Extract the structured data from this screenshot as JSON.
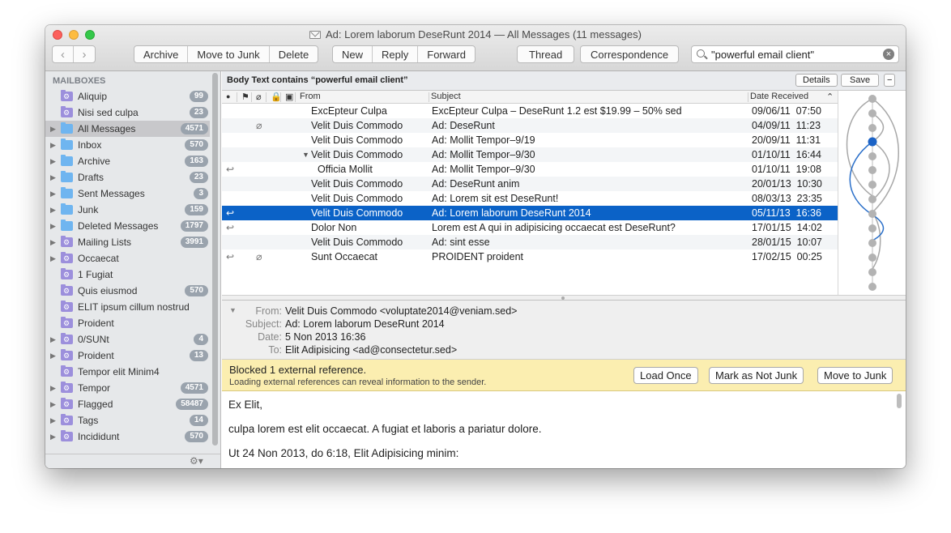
{
  "window": {
    "title": "Ad: Lorem laborum DeseRunt 2014 — All Messages (11 messages)"
  },
  "toolbar": {
    "back_icon": "chevron-left",
    "forward_icon": "chevron-right",
    "archive": "Archive",
    "move_to_junk": "Move to Junk",
    "delete": "Delete",
    "new": "New",
    "reply": "Reply",
    "forward": "Forward",
    "thread": "Thread",
    "correspondence": "Correspondence"
  },
  "search": {
    "value": "\"powerful email client\""
  },
  "sidebar": {
    "heading": "MAILBOXES",
    "items": [
      {
        "label": "Aliquip",
        "count": "99",
        "icon": "smart-folder",
        "disclosure": false,
        "selected": false
      },
      {
        "label": "Nisi sed culpa",
        "count": "23",
        "icon": "smart-folder",
        "disclosure": false,
        "selected": false
      },
      {
        "label": "All Messages",
        "count": "4571",
        "icon": "folder",
        "disclosure": true,
        "selected": true
      },
      {
        "label": "Inbox",
        "count": "570",
        "icon": "folder",
        "disclosure": true,
        "selected": false
      },
      {
        "label": "Archive",
        "count": "163",
        "icon": "folder",
        "disclosure": true,
        "selected": false
      },
      {
        "label": "Drafts",
        "count": "23",
        "icon": "folder",
        "disclosure": true,
        "selected": false
      },
      {
        "label": "Sent Messages",
        "count": "3",
        "icon": "folder",
        "disclosure": true,
        "selected": false
      },
      {
        "label": "Junk",
        "count": "159",
        "icon": "folder",
        "disclosure": true,
        "selected": false
      },
      {
        "label": "Deleted Messages",
        "count": "1797",
        "icon": "folder",
        "disclosure": true,
        "selected": false
      },
      {
        "label": "Mailing Lists",
        "count": "3991",
        "icon": "smart-folder",
        "disclosure": true,
        "selected": false
      },
      {
        "label": "Occaecat",
        "count": "",
        "icon": "smart-folder",
        "disclosure": true,
        "selected": false
      },
      {
        "label": "1 Fugiat",
        "count": "",
        "icon": "smart-folder",
        "disclosure": false,
        "selected": false
      },
      {
        "label": "Quis eiusmod",
        "count": "570",
        "icon": "smart-folder",
        "disclosure": false,
        "selected": false
      },
      {
        "label": "ELIT ipsum cillum nostrud",
        "count": "",
        "icon": "smart-folder",
        "disclosure": false,
        "selected": false
      },
      {
        "label": "Proident",
        "count": "",
        "icon": "smart-folder",
        "disclosure": false,
        "selected": false
      },
      {
        "label": "0/SUNt",
        "count": "4",
        "icon": "smart-folder",
        "disclosure": true,
        "selected": false
      },
      {
        "label": "Proident",
        "count": "13",
        "icon": "smart-folder",
        "disclosure": true,
        "selected": false
      },
      {
        "label": "Tempor elit Minim4",
        "count": "",
        "icon": "smart-folder",
        "disclosure": false,
        "selected": false
      },
      {
        "label": "Tempor",
        "count": "4571",
        "icon": "smart-folder",
        "disclosure": true,
        "selected": false
      },
      {
        "label": "Flagged",
        "count": "58487",
        "icon": "smart-folder",
        "disclosure": true,
        "selected": false
      },
      {
        "label": "Tags",
        "count": "14",
        "icon": "smart-folder",
        "disclosure": true,
        "selected": false
      },
      {
        "label": "Incididunt",
        "count": "570",
        "icon": "smart-folder",
        "disclosure": true,
        "selected": false
      }
    ]
  },
  "filter": {
    "text": "Body Text contains “powerful email client”",
    "details": "Details",
    "save": "Save",
    "remove": "−"
  },
  "columns": {
    "from": "From",
    "subject": "Subject",
    "date": "Date Received"
  },
  "messages": [
    {
      "from": "ExcEpteur Culpa",
      "subject": "ExcEpteur Culpa – DeseRunt 1.2 est $19.99 – 50% sed",
      "date": "09/06/11  07:50",
      "replied": false,
      "attachment": false,
      "selected": false,
      "indent": false,
      "thread_open": false
    },
    {
      "from": "Velit Duis Commodo",
      "subject": "Ad: DeseRunt",
      "date": "04/09/11  11:23",
      "replied": false,
      "attachment": true,
      "selected": false,
      "indent": false,
      "thread_open": false
    },
    {
      "from": "Velit Duis Commodo",
      "subject": "Ad: Mollit Tempor–9/19",
      "date": "20/09/11  11:31",
      "replied": false,
      "attachment": false,
      "selected": false,
      "indent": false,
      "thread_open": false
    },
    {
      "from": "Velit Duis Commodo",
      "subject": "Ad: Mollit Tempor–9/30",
      "date": "01/10/11  16:44",
      "replied": false,
      "attachment": false,
      "selected": false,
      "indent": false,
      "thread_open": true
    },
    {
      "from": "Officia Mollit",
      "subject": "Ad: Mollit Tempor–9/30",
      "date": "01/10/11  19:08",
      "replied": true,
      "attachment": false,
      "selected": false,
      "indent": true,
      "thread_open": false
    },
    {
      "from": "Velit Duis Commodo",
      "subject": "Ad: DeseRunt anim",
      "date": "20/01/13  10:30",
      "replied": false,
      "attachment": false,
      "selected": false,
      "indent": false,
      "thread_open": false
    },
    {
      "from": "Velit Duis Commodo",
      "subject": "Ad: Lorem sit est DeseRunt!",
      "date": "08/03/13  23:35",
      "replied": false,
      "attachment": false,
      "selected": false,
      "indent": false,
      "thread_open": false
    },
    {
      "from": "Velit Duis Commodo",
      "subject": "Ad: Lorem laborum DeseRunt 2014",
      "date": "05/11/13  16:36",
      "replied": true,
      "attachment": false,
      "selected": true,
      "indent": false,
      "thread_open": false
    },
    {
      "from": "Dolor Non",
      "subject": "Lorem est A qui in adipisicing occaecat est DeseRunt?",
      "date": "17/01/15  14:02",
      "replied": true,
      "attachment": false,
      "selected": false,
      "indent": false,
      "thread_open": false
    },
    {
      "from": "Velit Duis Commodo",
      "subject": "Ad: sint esse",
      "date": "28/01/15  10:07",
      "replied": false,
      "attachment": false,
      "selected": false,
      "indent": false,
      "thread_open": false
    },
    {
      "from": "Sunt Occaecat",
      "subject": "PROIDENT proident",
      "date": "17/02/15  00:25",
      "replied": true,
      "attachment": true,
      "selected": false,
      "indent": false,
      "thread_open": false
    }
  ],
  "message_header": {
    "from_label": "From:",
    "from": "Velit Duis Commodo <voluptate2014@veniam.sed>",
    "subject_label": "Subject:",
    "subject": "Ad: Lorem laborum DeseRunt 2014",
    "date_label": "Date:",
    "date": "5 Non 2013 16:36",
    "to_label": "To:",
    "to": "Elit Adipisicing <ad@consectetur.sed>"
  },
  "banner": {
    "title": "Blocked 1 external reference.",
    "subtitle": "Loading external references can reveal information to the sender.",
    "load_once": "Load Once",
    "not_junk": "Mark as Not Junk",
    "move_to_junk": "Move to Junk",
    "color": "#fbeeb0"
  },
  "body": {
    "line1": "Ex Elit,",
    "line2": "culpa lorem est elit occaecat. A fugiat et laboris a pariatur dolore.",
    "line3": "Ut 24 Non 2013, do 6:18, Elit Adipisicing minim:"
  },
  "colors": {
    "selection": "#0b62c7",
    "sidebar_bg": "#e6e8ea",
    "count_badge": "#9aa3ad"
  }
}
